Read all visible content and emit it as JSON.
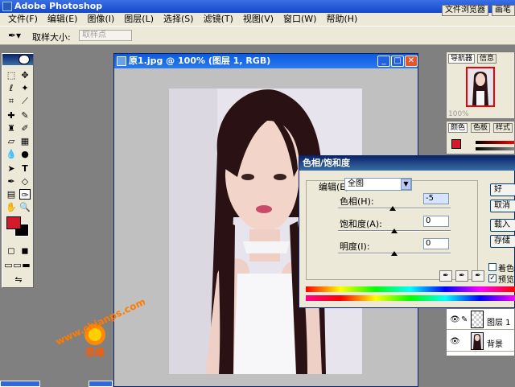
{
  "app": {
    "title": "Adobe Photoshop"
  },
  "menu": [
    "文件(F)",
    "编辑(E)",
    "图像(I)",
    "图层(L)",
    "选择(S)",
    "滤镜(T)",
    "视图(V)",
    "窗口(W)",
    "帮助(H)"
  ],
  "options": {
    "label": "取样大小:",
    "select_value": "取样点"
  },
  "palette_well": {
    "tabs": [
      "文件浏览器",
      "画笔"
    ]
  },
  "document": {
    "title": "原1.jpg @ 100% (图层 1, RGB)"
  },
  "dialog": {
    "title": "色相/饱和度",
    "edit_label": "编辑(E):",
    "edit_value": "全图",
    "hue_label": "色相(H):",
    "hue_value": "-5",
    "hue_level": -5,
    "sat_label": "饱和度(A):",
    "sat_value": "0",
    "sat_level": 0,
    "light_label": "明度(I):",
    "light_value": "0",
    "light_level": 0,
    "buttons": [
      "好",
      "取消",
      "载入",
      "存储"
    ],
    "colorize_label": "着色(O)",
    "preview_label": "预览(P)"
  },
  "navigator": {
    "tabs": [
      "导航器",
      "信息"
    ],
    "zoom": "100%"
  },
  "color_panel": {
    "tabs": [
      "颜色",
      "色板",
      "样式"
    ]
  },
  "layers": [
    {
      "name": "图层 1"
    },
    {
      "name": "背景"
    }
  ],
  "watermark": {
    "text": "www.chianps.com",
    "sub": "思缘"
  },
  "colors": {
    "foreground": "#d31a2a",
    "background": "#000000",
    "titlebar": "#1448c9"
  }
}
